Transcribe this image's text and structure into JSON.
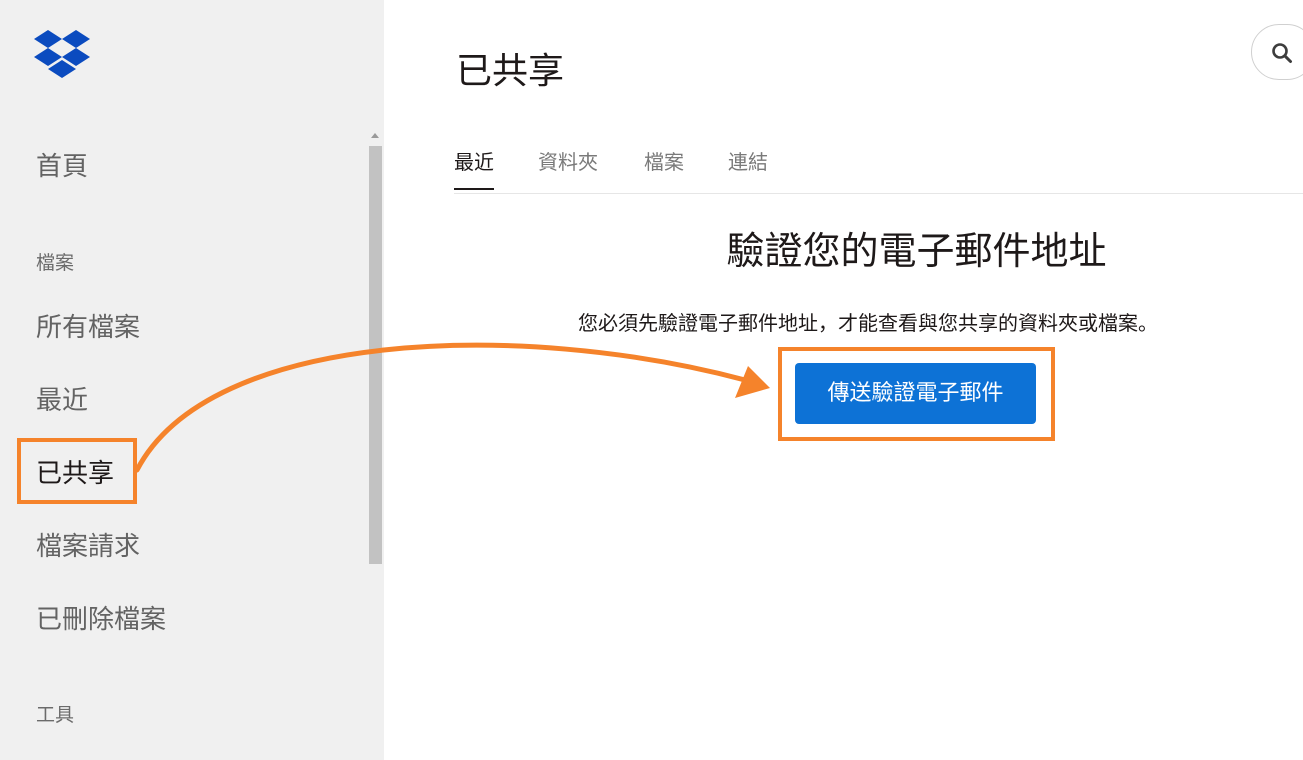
{
  "sidebar": {
    "logo": "dropbox-logo",
    "home": "首頁",
    "files_section": "檔案",
    "items": [
      {
        "label": "所有檔案"
      },
      {
        "label": "最近"
      },
      {
        "label": "已共享"
      },
      {
        "label": "檔案請求"
      },
      {
        "label": "已刪除檔案"
      }
    ],
    "tools_section": "工具"
  },
  "header": {
    "title": "已共享",
    "search_icon": "search-icon"
  },
  "tabs": [
    {
      "label": "最近",
      "active": true
    },
    {
      "label": "資料夾",
      "active": false
    },
    {
      "label": "檔案",
      "active": false
    },
    {
      "label": "連結",
      "active": false
    }
  ],
  "main": {
    "heading": "驗證您的電子郵件地址",
    "description": "您必須先驗證電子郵件地址，才能查看與您共享的資料夾或檔案。",
    "send_button": "傳送驗證電子郵件"
  },
  "colors": {
    "accent": "#0d72d6",
    "annotation": "#f5832b",
    "sidebar_bg": "#f0f0f0"
  }
}
